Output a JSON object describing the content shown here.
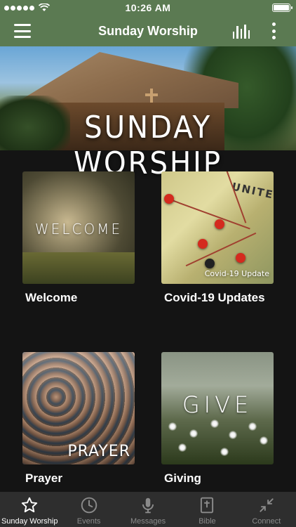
{
  "status_bar": {
    "time": "10:26 AM"
  },
  "header": {
    "title": "Sunday Worship"
  },
  "banner": {
    "title": "SUNDAY WORSHIP"
  },
  "tiles": [
    {
      "label": "Welcome",
      "image_text": "WELCOME"
    },
    {
      "label": "Covid-19 Updates",
      "image_text": "Covid-19 Update",
      "map_text": "UNITED"
    },
    {
      "label": "Prayer",
      "image_text": "PRAYER"
    },
    {
      "label": "Giving",
      "image_text": "GIVE"
    }
  ],
  "tab_bar": {
    "items": [
      {
        "label": "Sunday Worship",
        "icon": "star-icon",
        "active": true
      },
      {
        "label": "Events",
        "icon": "clock-icon",
        "active": false
      },
      {
        "label": "Messages",
        "icon": "microphone-icon",
        "active": false
      },
      {
        "label": "Bible",
        "icon": "bible-icon",
        "active": false
      },
      {
        "label": "Connect",
        "icon": "collapse-arrows-icon",
        "active": false
      }
    ]
  },
  "colors": {
    "header_bg": "#5b7a52",
    "page_bg": "#141414",
    "tab_bar_bg": "#2e2e2e",
    "tab_active": "#ffffff",
    "tab_inactive": "#8a8a8a"
  }
}
